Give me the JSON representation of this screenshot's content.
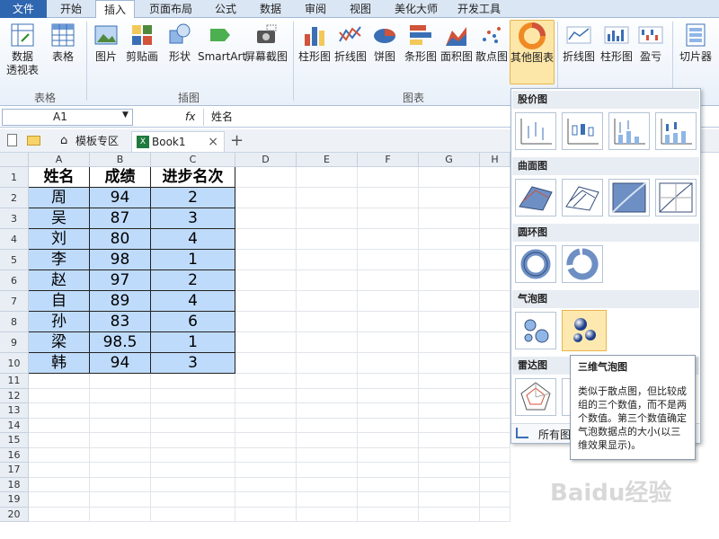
{
  "menubar": {
    "items": [
      "文件",
      "开始",
      "插入",
      "页面布局",
      "公式",
      "数据",
      "审阅",
      "视图",
      "美化大师",
      "开发工具"
    ],
    "active": "插入"
  },
  "ribbon": {
    "buttons": [
      "数据\n透视表",
      "表格",
      "图片",
      "剪贴画",
      "形状",
      "SmartArt",
      "屏幕截图",
      "柱形图",
      "折线图",
      "饼图",
      "条形图",
      "面积图",
      "散点图",
      "其他图表",
      "折线图",
      "柱形图",
      "盈亏",
      "切片器"
    ],
    "groups": [
      "表格",
      "插图",
      "图表"
    ]
  },
  "formula": {
    "cell": "A1",
    "fx": "fx",
    "content": "姓名"
  },
  "tabs": {
    "template": "模板专区",
    "book": "Book1",
    "close": "×",
    "add": "+"
  },
  "sheet": {
    "columns": [
      "A",
      "B",
      "C",
      "D",
      "E",
      "F",
      "G",
      "H"
    ],
    "rows": [
      "1",
      "2",
      "3",
      "4",
      "5",
      "6",
      "7",
      "8",
      "9",
      "10",
      "11",
      "12",
      "13",
      "14",
      "15",
      "16",
      "17",
      "18",
      "19",
      "20"
    ],
    "headers": [
      "姓名",
      "成绩",
      "进步名次"
    ],
    "data": [
      [
        "周",
        "94",
        "2"
      ],
      [
        "吴",
        "87",
        "3"
      ],
      [
        "刘",
        "80",
        "4"
      ],
      [
        "李",
        "98",
        "1"
      ],
      [
        "赵",
        "97",
        "2"
      ],
      [
        "自",
        "89",
        "4"
      ],
      [
        "孙",
        "83",
        "6"
      ],
      [
        "梁",
        "98.5",
        "1"
      ],
      [
        "韩",
        "94",
        "3"
      ]
    ]
  },
  "dropdown": {
    "sections": [
      "股价图",
      "曲面图",
      "圆环图",
      "气泡图",
      "雷达图"
    ],
    "footer": "所有图"
  },
  "tooltip": {
    "title": "三维气泡图",
    "body": "类似于散点图，但比较成组的三个数值，而不是两个数值。第三个数值确定气泡数据点的大小(以三维效果显示)。"
  },
  "watermark": "Baidu经验"
}
